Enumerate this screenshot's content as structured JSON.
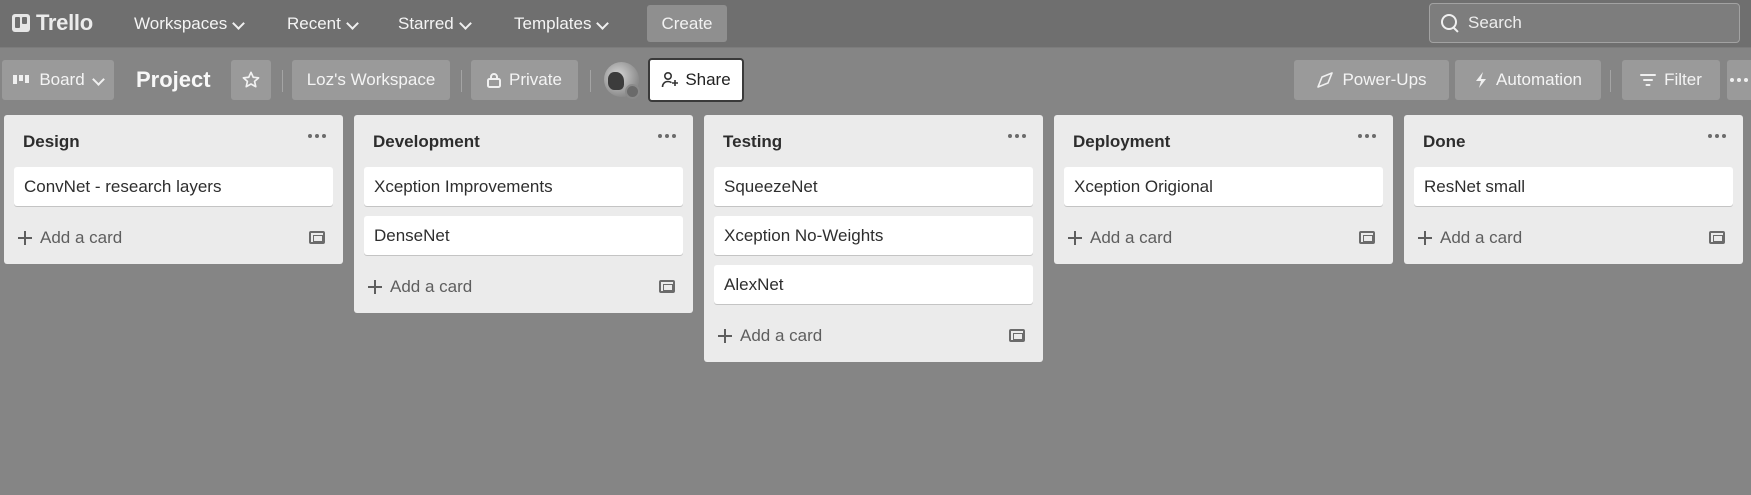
{
  "app": {
    "brand": "Trello",
    "nav": {
      "workspaces": "Workspaces",
      "recent": "Recent",
      "starred": "Starred",
      "templates": "Templates",
      "create": "Create"
    },
    "search": {
      "placeholder": "Search"
    }
  },
  "board": {
    "view_label": "Board",
    "title": "Project",
    "workspace_label": "Loz's Workspace",
    "visibility_label": "Private",
    "share_label": "Share",
    "powerups_label": "Power-Ups",
    "automation_label": "Automation",
    "filter_label": "Filter"
  },
  "lists": [
    {
      "title": "Design",
      "cards": [
        "ConvNet - research layers"
      ],
      "add_label": "Add a card"
    },
    {
      "title": "Development",
      "cards": [
        "Xception Improvements",
        "DenseNet"
      ],
      "add_label": "Add a card"
    },
    {
      "title": "Testing",
      "cards": [
        "SqueezeNet",
        "Xception No-Weights",
        "AlexNet"
      ],
      "add_label": "Add a card"
    },
    {
      "title": "Deployment",
      "cards": [
        "Xception Origional"
      ],
      "add_label": "Add a card"
    },
    {
      "title": "Done",
      "cards": [
        "ResNet small"
      ],
      "add_label": "Add a card"
    }
  ],
  "colors": {
    "background": "#858585",
    "topbar": "#6f6f6f",
    "list": "#ebebeb",
    "card": "#ffffff"
  }
}
